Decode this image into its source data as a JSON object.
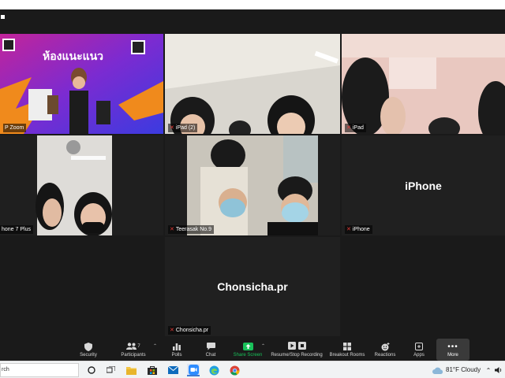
{
  "participants": [
    {
      "id": "p1",
      "label": "P Zoom",
      "big_label": "",
      "banner_text": "ห้องแนะแนว"
    },
    {
      "id": "p2",
      "label": "iPad (2)",
      "big_label": ""
    },
    {
      "id": "p3",
      "label": "iPad",
      "big_label": ""
    },
    {
      "id": "p4",
      "label": "hone 7 Plus",
      "big_label": ""
    },
    {
      "id": "p5",
      "label": "Teerasak No.9",
      "big_label": ""
    },
    {
      "id": "p6",
      "label": "iPhone",
      "big_label": "iPhone"
    },
    {
      "id": "p7",
      "label": "Chonsicha.pr",
      "big_label": "Chonsicha.pr"
    }
  ],
  "toolbar": {
    "security": "Security",
    "participants": "Participants",
    "participants_count": "7",
    "polls": "Polls",
    "chat": "Chat",
    "share_screen": "Share Screen",
    "recording": "Resume/Stop Recording",
    "breakout": "Breakout Rooms",
    "reactions": "Reactions",
    "apps": "Apps",
    "more": "More"
  },
  "taskbar": {
    "search_text": "rch",
    "weather": "81°F  Cloudy"
  },
  "colors": {
    "share_green": "#19c15a",
    "speaker_outline": "#f2e600",
    "muted_red": "#e53935"
  }
}
